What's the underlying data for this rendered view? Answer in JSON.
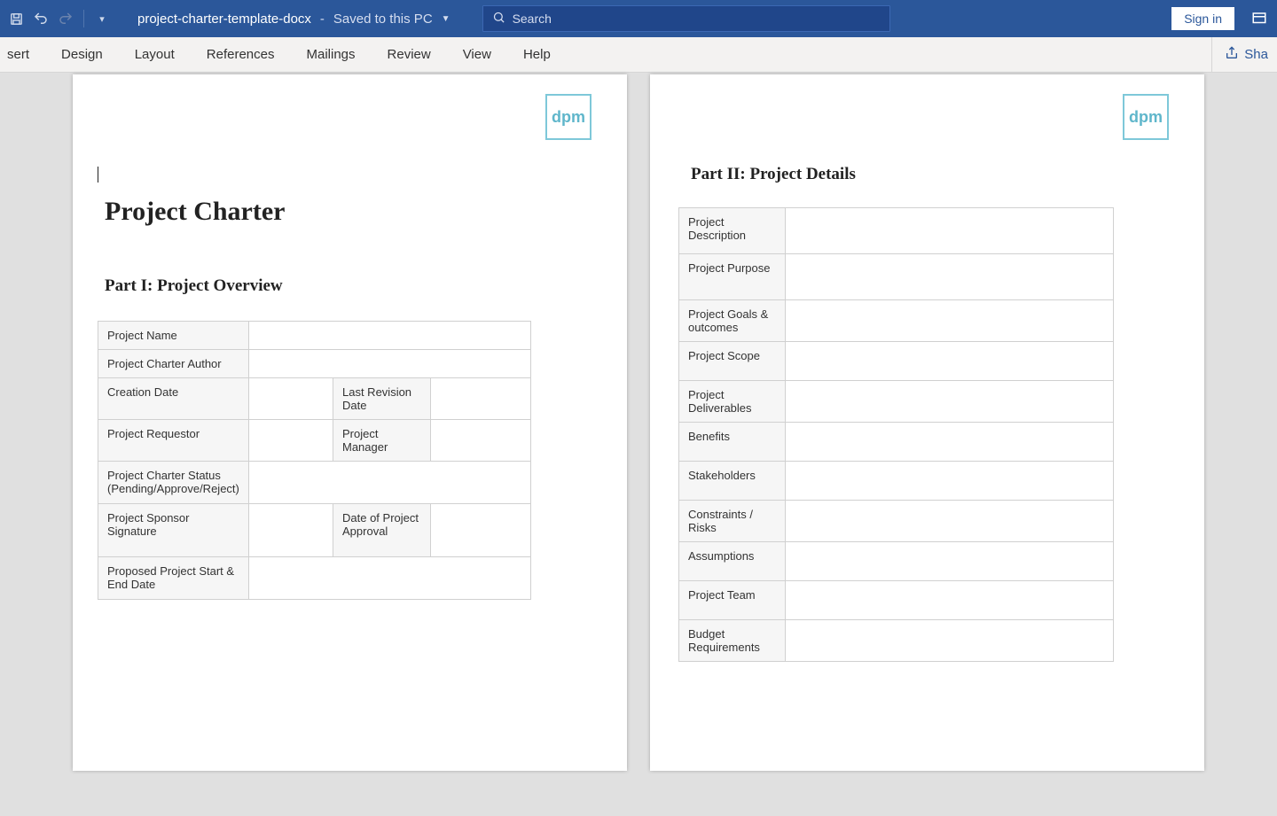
{
  "titlebar": {
    "filename": "project-charter-template-docx",
    "saved_status": "Saved to this PC",
    "search_placeholder": "Search",
    "signin": "Sign in"
  },
  "ribbon": {
    "tabs": [
      "sert",
      "Design",
      "Layout",
      "References",
      "Mailings",
      "Review",
      "View",
      "Help"
    ],
    "share": "Sha"
  },
  "logo_text": "dpm",
  "page1": {
    "title": "Project Charter",
    "section": "Part I: Project Overview",
    "rows": {
      "project_name": "Project Name",
      "charter_author": "Project Charter Author",
      "creation_date": "Creation Date",
      "last_revision": "Last Revision Date",
      "requestor": "Project Requestor",
      "manager": "Project Manager",
      "charter_status": "Project Charter Status (Pending/Approve/Reject)",
      "sponsor_sig": "Project Sponsor Signature",
      "date_approval": "Date of Project Approval",
      "proposed_dates": "Proposed Project Start & End Date"
    }
  },
  "page2": {
    "section": "Part II: Project Details",
    "rows": {
      "description": "Project Description",
      "purpose": "Project Purpose",
      "goals": "Project Goals & outcomes",
      "scope": "Project Scope",
      "deliverables": "Project Deliverables",
      "benefits": "Benefits",
      "stakeholders": "Stakeholders",
      "constraints": "Constraints / Risks",
      "assumptions": "Assumptions",
      "team": "Project Team",
      "budget": "Budget Requirements"
    }
  }
}
